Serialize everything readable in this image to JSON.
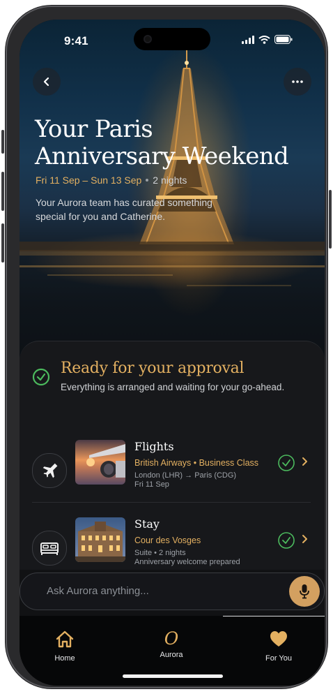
{
  "status": {
    "time": "9:41"
  },
  "hero": {
    "title_line1": "Your Paris",
    "title_line2": "Anniversary Weekend",
    "dates": "Fri 11 Sep – Sun 13 Sep",
    "nights": "2 nights",
    "intro": "Your Aurora team has curated something special for you and Catherine."
  },
  "approval": {
    "title": "Ready for your approval",
    "subtitle": "Everything is arranged and waiting for your go-ahead."
  },
  "items": [
    {
      "title": "Flights",
      "subtitle": "British Airways • Business Class",
      "detail1": "London (LHR) → Paris (CDG)",
      "detail2": "Fri 11 Sep",
      "icon": "airplane-icon"
    },
    {
      "title": "Stay",
      "subtitle": "Cour des Vosges",
      "detail1": "Suite • 2 nights",
      "detail2": "Anniversary welcome prepared",
      "icon": "bed-icon"
    }
  ],
  "ask": {
    "placeholder": "Ask Aurora anything..."
  },
  "tabs": [
    {
      "label": "Home",
      "icon": "home-icon"
    },
    {
      "label": "Aurora",
      "icon": "aurora-logo-icon",
      "glyph": "O"
    },
    {
      "label": "For You",
      "icon": "heart-icon"
    }
  ],
  "colors": {
    "accent": "#e3b061",
    "success": "#4cbb5e",
    "background": "#17181b"
  }
}
